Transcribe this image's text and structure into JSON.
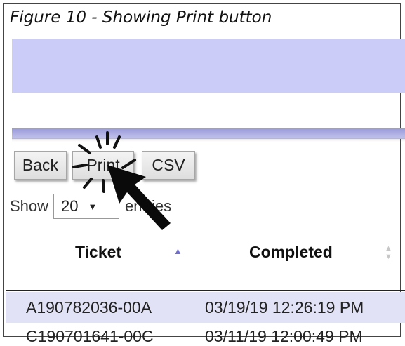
{
  "caption": "Figure 10 - Showing Print button",
  "buttons": {
    "back": "Back",
    "print": "Print",
    "csv": "CSV"
  },
  "length_control": {
    "show_label": "Show",
    "selected": "20",
    "entries_label": "entries"
  },
  "table": {
    "columns": [
      "Ticket",
      "Completed"
    ],
    "rows": [
      [
        "A190782036-00A",
        "03/19/19 12:26:19 PM"
      ],
      [
        "C190701641-00C",
        "03/11/19 12:00:49 PM"
      ]
    ]
  },
  "colors": {
    "header_band": "#ccccf8",
    "nav_bar": "#9b9bd9",
    "selected_row": "#e2e2f6",
    "sort_active": "#6e6ed0"
  },
  "icons": [
    "click-burst-icon",
    "mouse-pointer-icon",
    "dropdown-arrow-icon",
    "sort-asc-icon",
    "sort-both-icon"
  ]
}
